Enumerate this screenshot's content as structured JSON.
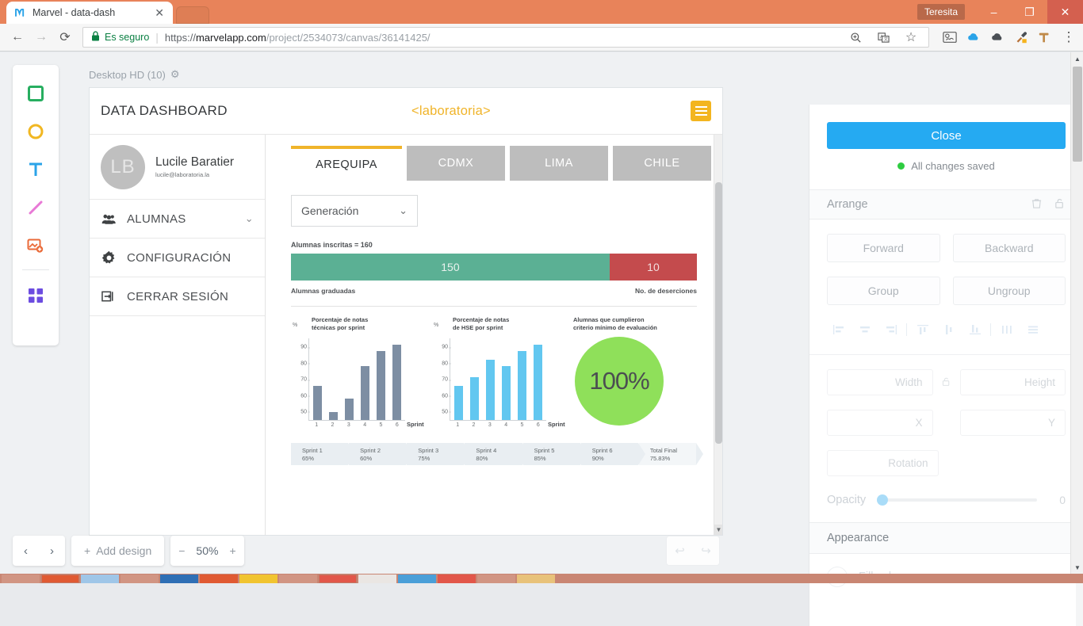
{
  "browser": {
    "tab": {
      "title": "Marvel - data-dash",
      "favicon": "marvel-logo-icon",
      "close": "✕"
    },
    "window": {
      "user": "Teresita",
      "minimize": "–",
      "maximize": "❐",
      "close": "✕"
    },
    "nav": {
      "back": "←",
      "forward": "→",
      "reload": "⟳"
    },
    "omnibox": {
      "lock": "🔒",
      "secure_label": "Es seguro",
      "url_scheme": "https://",
      "url_domain": "marvelapp.com",
      "url_path": "/project/2534073/canvas/36141425/",
      "zoom_icon": "⊕",
      "translate_icon": "translate-icon",
      "bookmark_icon": "☆"
    },
    "extensions": [
      "weather-icon",
      "cloud-upload-icon",
      "cloud-icon",
      "eyedropper-icon",
      "tool-icon"
    ],
    "menu_icon": "⋮"
  },
  "palette": {
    "tools": [
      {
        "name": "rectangle-tool",
        "color": "#27ae60"
      },
      {
        "name": "ellipse-tool",
        "color": "#f1b722"
      },
      {
        "name": "text-tool",
        "color": "#2aa3e8",
        "glyph": "T"
      },
      {
        "name": "line-tool",
        "color": "#e879d6"
      },
      {
        "name": "image-tool",
        "color": "#ea6a38"
      },
      {
        "name": "components-tool",
        "color": "#6c4ce0"
      }
    ]
  },
  "canvas": {
    "artboard_label": "Desktop HD (10)",
    "gear_icon": "⚙"
  },
  "dashboard": {
    "title": "DATA DASHBOARD",
    "brand": "<laboratoria>",
    "menu_icon": "hamburger-icon",
    "profile": {
      "initials": "LB",
      "name": "Lucile Baratier",
      "email": "lucile@laboratoria.la"
    },
    "menu": [
      {
        "label": "ALUMNAS",
        "icon": "users-icon",
        "chevron": "⌄"
      },
      {
        "label": "CONFIGURACIÓN",
        "icon": "gear-icon"
      },
      {
        "label": "CERRAR SESIÓN",
        "icon": "logout-icon"
      }
    ],
    "tabs": [
      {
        "label": "AREQUIPA",
        "active": true
      },
      {
        "label": "CDMX",
        "active": false
      },
      {
        "label": "LIMA",
        "active": false
      },
      {
        "label": "CHILE",
        "active": false
      }
    ],
    "filter": {
      "label": "Generación",
      "chevron": "⌄"
    },
    "enrolled_label": "Alumnas inscritas = 160",
    "stat_bar": {
      "graduated_value": "150",
      "graduated_label": "Alumnas graduadas",
      "dropout_value": "10",
      "dropout_label": "No. de deserciones",
      "graduated_color": "#5bb094",
      "dropout_color": "#c44b4d"
    },
    "kpi": {
      "title_line1": "Alumnas que cumplieron",
      "title_line2": "criterio mínimo de evaluación",
      "value": "100%",
      "color": "#8fe05a"
    },
    "sprints": [
      {
        "name": "Sprint 1",
        "value": "65%"
      },
      {
        "name": "Sprint 2",
        "value": "60%"
      },
      {
        "name": "Sprint 3",
        "value": "75%"
      },
      {
        "name": "Sprint 4",
        "value": "80%"
      },
      {
        "name": "Sprint 5",
        "value": "85%"
      },
      {
        "name": "Sprint 6",
        "value": "90%"
      },
      {
        "name": "Total Final",
        "value": "75.83%"
      }
    ]
  },
  "chart_data": [
    {
      "type": "bar",
      "title": "Porcentaje de notas técnicas por sprint",
      "title_line1": "Porcentaje de notas",
      "title_line2": "técnicas por sprint",
      "xlabel": "Sprint",
      "ylabel": "%",
      "categories": [
        "1",
        "2",
        "3",
        "4",
        "5",
        "6"
      ],
      "values": [
        65,
        49,
        57,
        77,
        86,
        90
      ],
      "yticks": [
        "50",
        "60",
        "70",
        "80",
        "90"
      ],
      "ylim": [
        44,
        94
      ],
      "color": "#7d8ea3",
      "grid": false,
      "legend": "none"
    },
    {
      "type": "bar",
      "title": "Porcentaje de notas de HSE por sprint",
      "title_line1": "Porcentaje de notas",
      "title_line2": "de HSE por sprint",
      "xlabel": "Sprint",
      "ylabel": "%",
      "categories": [
        "1",
        "2",
        "3",
        "4",
        "5",
        "6"
      ],
      "values": [
        65,
        70,
        81,
        77,
        86,
        90
      ],
      "yticks": [
        "50",
        "60",
        "70",
        "80",
        "90"
      ],
      "ylim": [
        44,
        94
      ],
      "color": "#62c7f0",
      "grid": false,
      "legend": "none"
    }
  ],
  "bottombar": {
    "prev": "‹",
    "next": "›",
    "add_design": "Add design",
    "add_icon": "+",
    "zoom_out": "−",
    "zoom_value": "50%",
    "zoom_in": "+",
    "undo": "↩",
    "redo": "↪"
  },
  "right_panel": {
    "close_label": "Close",
    "save_status": "All changes saved",
    "status_color": "#2ecc40",
    "arrange": {
      "title": "Arrange",
      "delete_icon": "trash-icon",
      "lock_icon": "unlock-icon",
      "buttons": [
        "Forward",
        "Backward",
        "Group",
        "Ungroup"
      ],
      "align_icons": [
        "align-left-icon",
        "align-center-h-icon",
        "align-right-icon",
        "align-top-icon",
        "align-middle-v-icon",
        "align-bottom-icon",
        "distribute-h-icon",
        "distribute-v-icon"
      ]
    },
    "fields": {
      "width": "Width",
      "height": "Height",
      "x": "X",
      "y": "Y",
      "rotation": "Rotation",
      "lock_icon": "unlock-icon"
    },
    "opacity": {
      "label": "Opacity",
      "value": "0"
    },
    "appearance": {
      "title": "Appearance",
      "fill_label": "Fill color"
    }
  }
}
